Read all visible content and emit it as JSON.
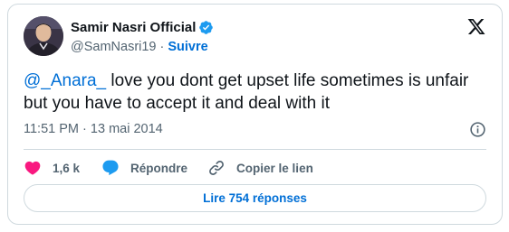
{
  "author": {
    "display_name": "Samir Nasri Official",
    "handle": "@SamNasri19",
    "separator": "·",
    "follow_label": "Suivre",
    "verified_color": "#1d9bf0"
  },
  "tweet": {
    "mention": "@_Anara_",
    "text": " love you dont get upset life sometimes is unfair but you have to accept it and deal with it",
    "time": "11:51 PM",
    "date_separator": "·",
    "date": "13 mai 2014"
  },
  "actions": {
    "like_count": "1,6 k",
    "reply_label": "Répondre",
    "copy_link_label": "Copier le lien"
  },
  "read_replies_label": "Lire 754 réponses",
  "colors": {
    "link": "#006fd6",
    "heart": "#f91880",
    "reply_bubble": "#1d9bf0",
    "secondary_text": "#536471",
    "border": "#cfd9de"
  },
  "icons": {
    "brand": "x-logo-icon",
    "verified": "verified-badge-icon",
    "info": "info-icon",
    "like": "heart-icon",
    "reply": "reply-bubble-icon",
    "copy_link": "link-icon"
  }
}
